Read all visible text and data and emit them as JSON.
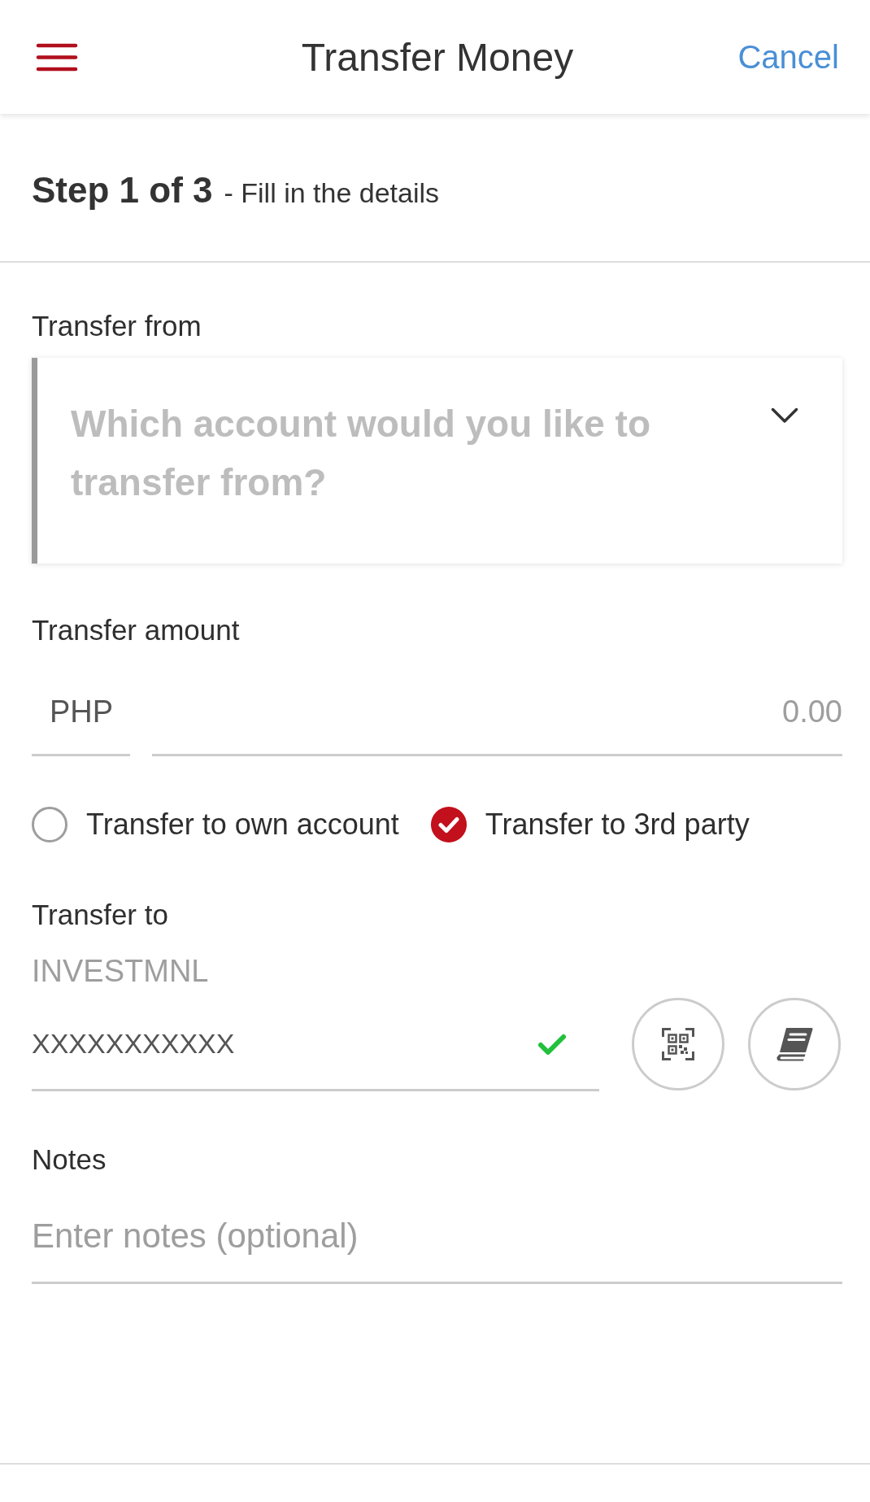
{
  "header": {
    "title": "Transfer Money",
    "cancel": "Cancel"
  },
  "step": {
    "step": "Step 1 of 3",
    "description": "- Fill in the details"
  },
  "transfer_from": {
    "label": "Transfer from",
    "placeholder": "Which account would you like to transfer from?"
  },
  "transfer_amount": {
    "label": "Transfer amount",
    "currency": "PHP",
    "placeholder": "0.00"
  },
  "transfer_type": [
    {
      "label": "Transfer to own account",
      "selected": false
    },
    {
      "label": "Transfer to 3rd party",
      "selected": true
    }
  ],
  "transfer_to": {
    "label": "Transfer to",
    "bank": "INVESTMNL",
    "account": "XXXXXXXXXXX",
    "verified": true
  },
  "notes": {
    "label": "Notes",
    "placeholder": "Enter notes (optional)"
  }
}
